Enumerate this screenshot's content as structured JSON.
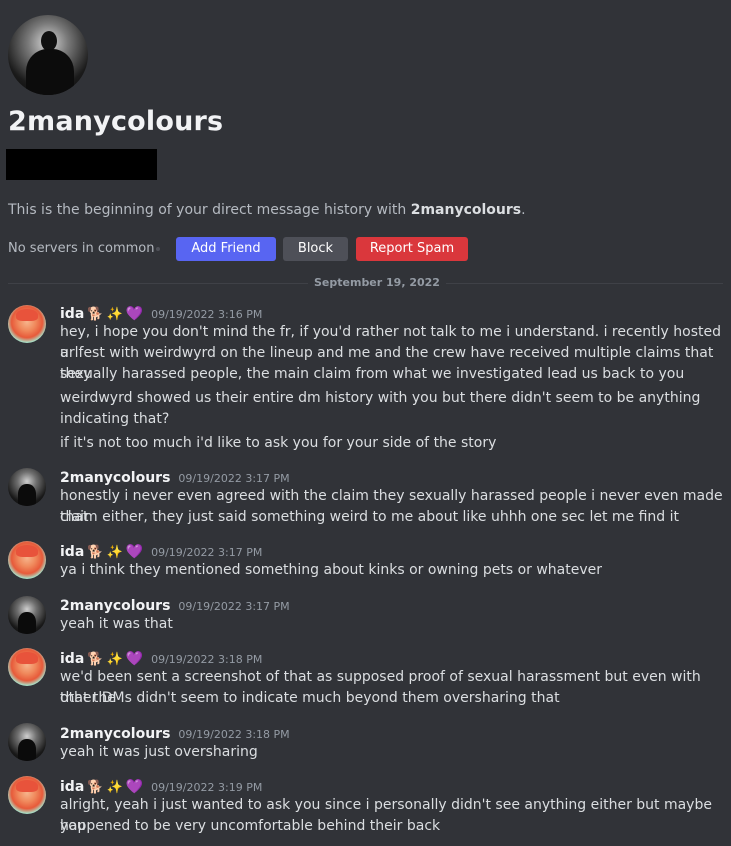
{
  "profile": {
    "name": "2manycolours",
    "intro_prefix": "This is the beginning of your direct message history with ",
    "intro_name": "2manycolours",
    "intro_suffix": "."
  },
  "actions": {
    "no_servers": "No servers in common",
    "add_friend": "Add Friend",
    "block": "Block",
    "report_spam": "Report Spam"
  },
  "divider": {
    "date": "September 19, 2022"
  },
  "messages": [
    {
      "author": "ida",
      "emojis": [
        "🐕",
        "✨",
        "💜"
      ],
      "timestamp": "09/19/2022 3:16 PM",
      "lines": [
        "hey, i hope you don't mind the fr, if you'd rather not talk to me i understand. i recently hosted a",
        "urlfest with weirdwyrd on the lineup and me and the crew have received multiple claims that they",
        "sexually harassed people, the main claim from what we investigated lead us back to you",
        "weirdwyrd showed us their entire dm history with you but there didn't seem to be anything",
        "indicating that?",
        "if it's not too much i'd like to ask you for your side of the story"
      ]
    },
    {
      "author": "2manycolours",
      "timestamp": "09/19/2022 3:17 PM",
      "lines": [
        "honestly i never even agreed with the claim they sexually harassed people i never even made that",
        "claim either, they just said something weird to me about like uhhh one sec let me find it"
      ]
    },
    {
      "author": "ida",
      "emojis": [
        "🐕",
        "✨",
        "💜"
      ],
      "timestamp": "09/19/2022 3:17 PM",
      "lines": [
        "ya i think they mentioned something about kinks or owning pets or whatever"
      ]
    },
    {
      "author": "2manycolours",
      "timestamp": "09/19/2022 3:17 PM",
      "lines": [
        "yeah it was that"
      ]
    },
    {
      "author": "ida",
      "emojis": [
        "🐕",
        "✨",
        "💜"
      ],
      "timestamp": "09/19/2022 3:18 PM",
      "lines": [
        "we'd been sent a screenshot of that as supposed proof of sexual harassment but even with that the",
        "other DMs didn't seem to indicate much beyond them oversharing that"
      ]
    },
    {
      "author": "2manycolours",
      "timestamp": "09/19/2022 3:18 PM",
      "lines": [
        "yeah it was just oversharing"
      ]
    },
    {
      "author": "ida",
      "emojis": [
        "🐕",
        "✨",
        "💜"
      ],
      "timestamp": "09/19/2022 3:19 PM",
      "lines": [
        "alright, yeah i just wanted to ask you since i personally didn't see anything either but maybe you",
        "happened to be very uncomfortable behind their back"
      ]
    }
  ]
}
